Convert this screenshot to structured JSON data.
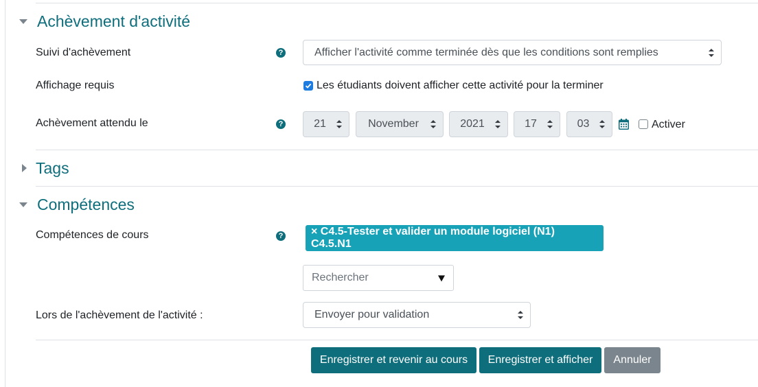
{
  "completion": {
    "title": "Achèvement d'activité",
    "tracking_label": "Suivi d'achèvement",
    "tracking_value": "Afficher l'activité comme terminée dès que les conditions sont remplies",
    "view_label": "Affichage requis",
    "view_checkbox_label": "Les étudiants doivent afficher cette activité pour la terminer",
    "expected_label": "Achèvement attendu le",
    "date": {
      "day": "21",
      "month": "November",
      "year": "2021",
      "hour": "17",
      "minute": "03"
    },
    "enable_label": "Activer"
  },
  "tags": {
    "title": "Tags"
  },
  "competencies": {
    "title": "Compétences",
    "course_label": "Compétences de cours",
    "selected_badge": "× C4.5-Tester et valider un module logiciel (N1) C4.5.N1",
    "search_placeholder": "Rechercher",
    "on_completion_label": "Lors de l'achèvement de l'activité :",
    "on_completion_value": "Envoyer pour validation"
  },
  "buttons": {
    "save_return": "Enregistrer et revenir au cours",
    "save_display": "Enregistrer et afficher",
    "cancel": "Annuler"
  },
  "help_glyph": "?",
  "colors": {
    "accent": "#0f6e7c",
    "badge": "#17a2b8",
    "checkbox": "#1e7ce0",
    "secondary": "#7b858d"
  }
}
